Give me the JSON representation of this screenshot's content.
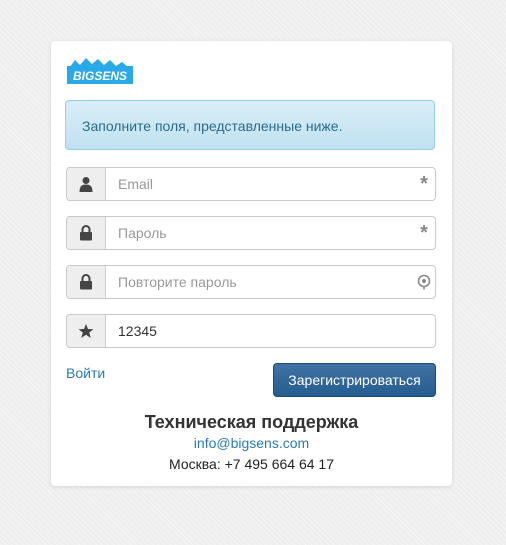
{
  "brand": {
    "logo_text": "BIGSENS",
    "color": "#29a9e6"
  },
  "alert": {
    "text": "Заполните поля, представленные ниже."
  },
  "form": {
    "fields": [
      {
        "icon": "user-icon",
        "placeholder": "Email",
        "value": "",
        "suffix": "required-asterisk"
      },
      {
        "icon": "lock-icon",
        "placeholder": "Пароль",
        "value": "",
        "suffix": "required-asterisk"
      },
      {
        "icon": "lock-icon",
        "placeholder": "Повторите пароль",
        "value": "",
        "suffix": "password-match-indicator-icon"
      },
      {
        "icon": "star-icon",
        "placeholder": "",
        "value": "12345",
        "suffix": ""
      }
    ],
    "required_mark": "*"
  },
  "actions": {
    "login_label": "Войти",
    "register_label": "Зарегистрироваться",
    "primary_color": "#2f6497",
    "link_color": "#2a7ab8"
  },
  "support": {
    "title": "Техническая поддержка",
    "email": "info@bigsens.com",
    "phone": "Москва: +7 495 664 64 17"
  }
}
